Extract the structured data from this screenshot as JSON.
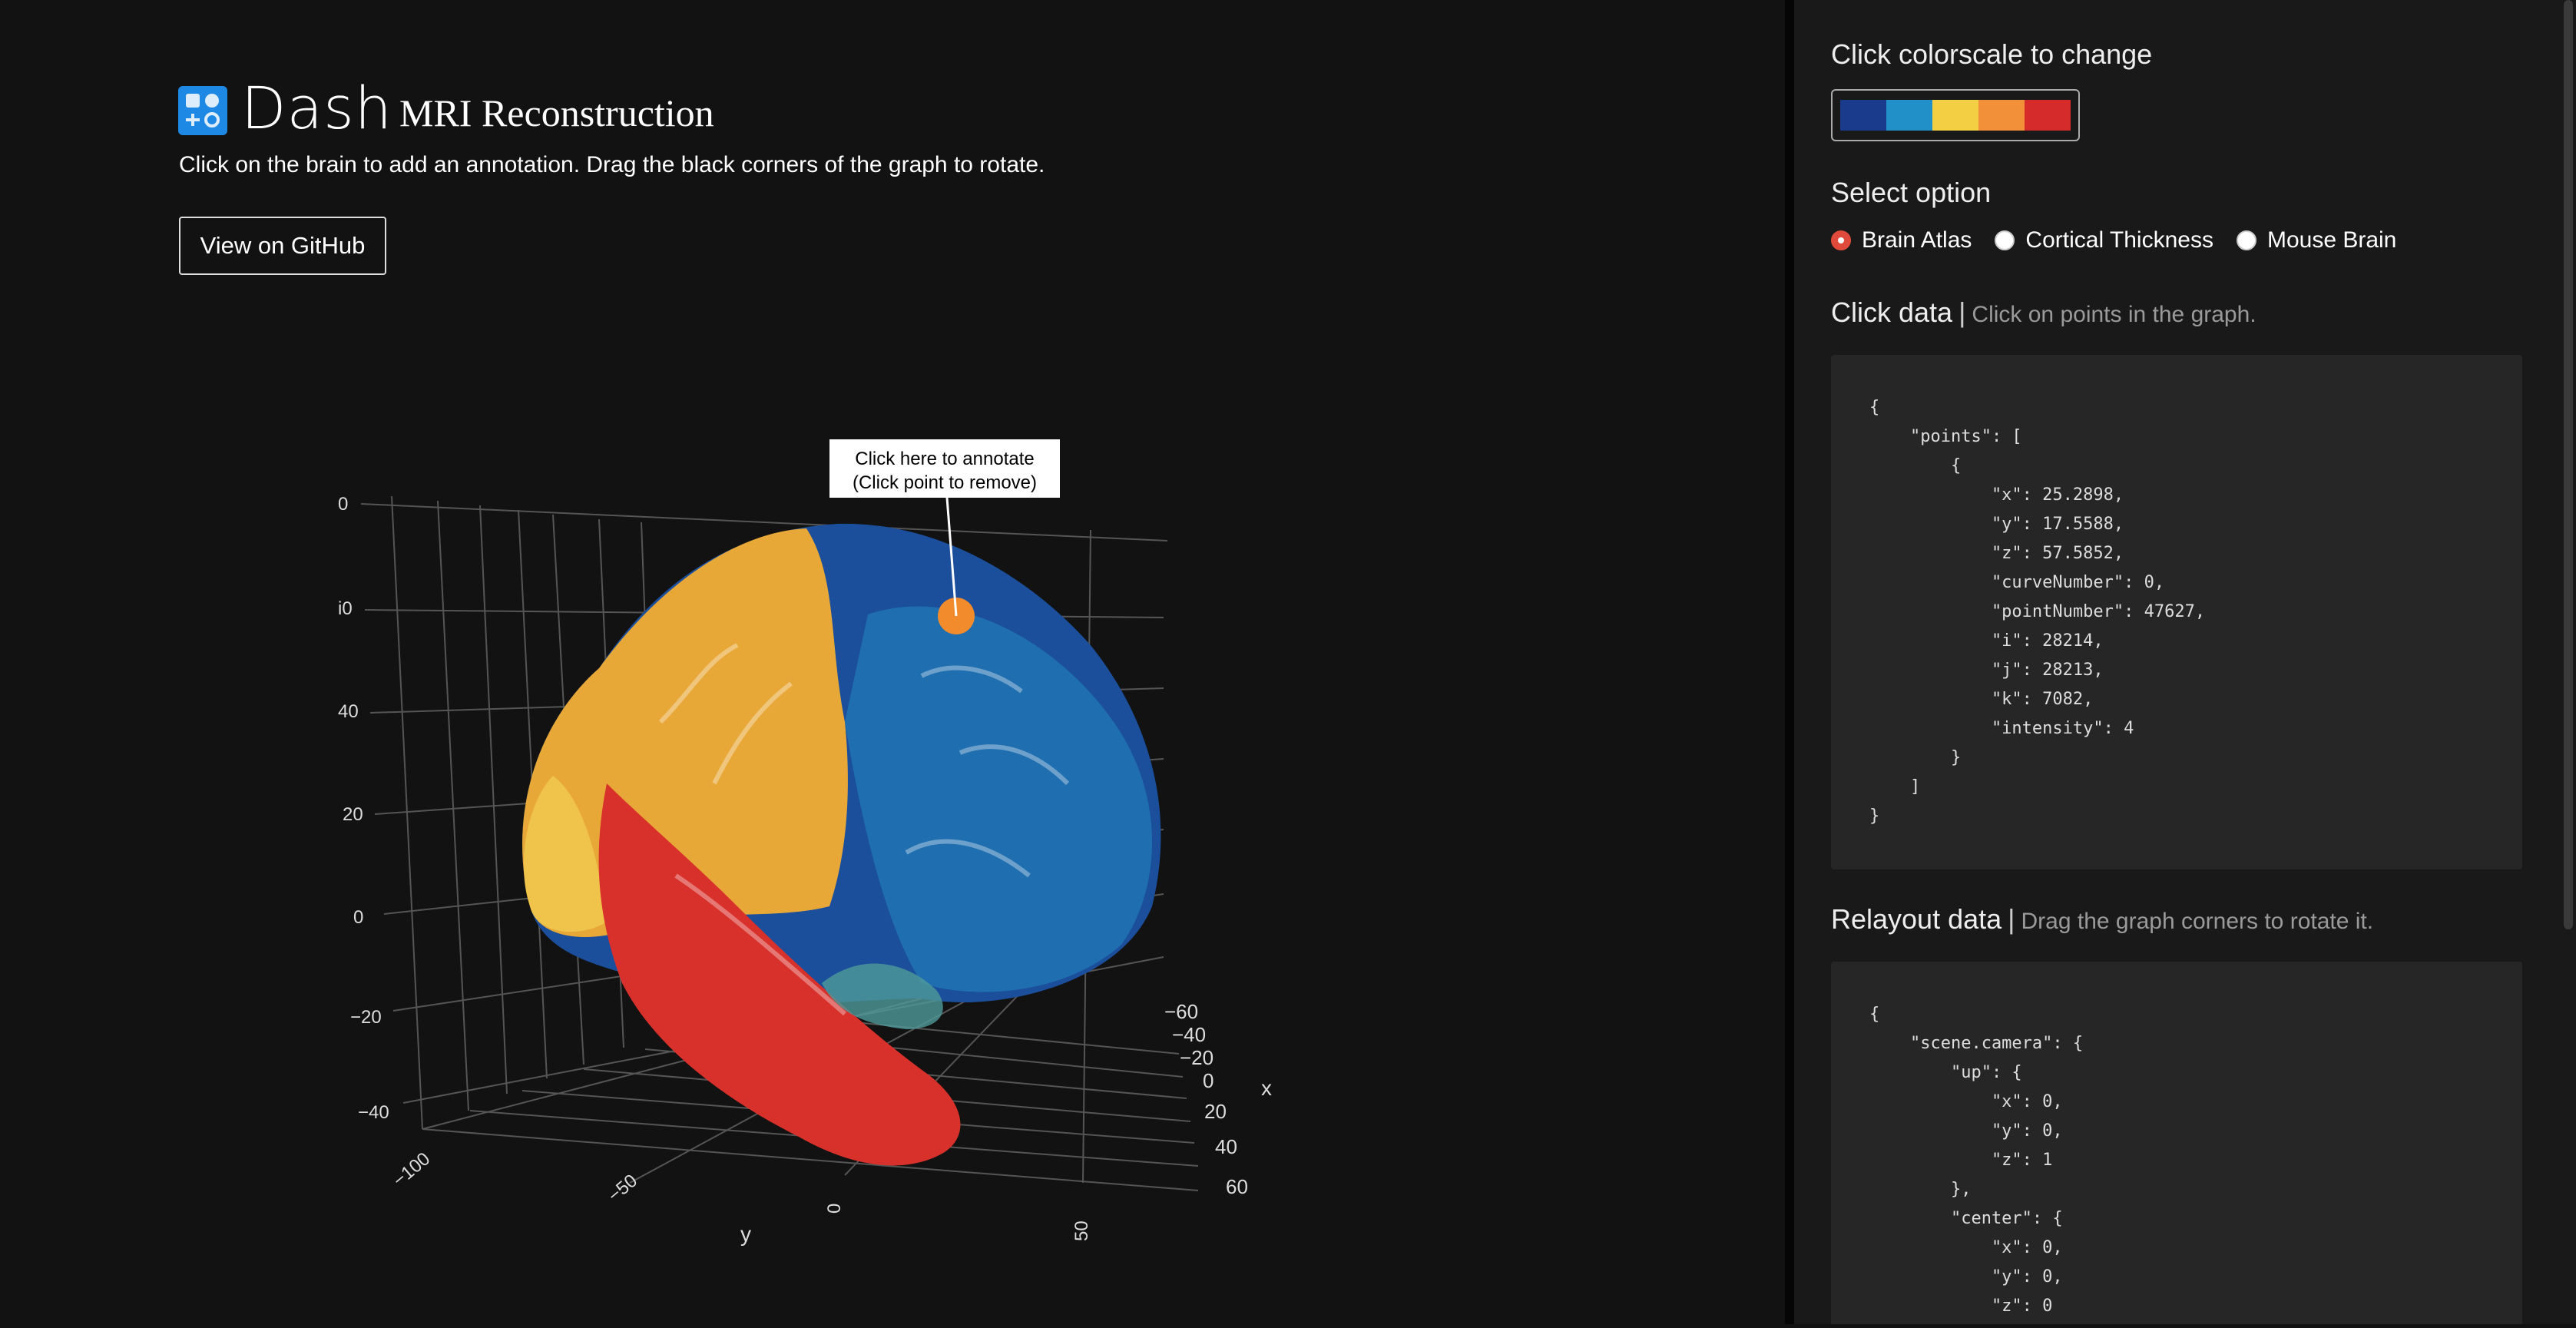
{
  "header": {
    "logo_text": "Dash",
    "app_title": "MRI Reconstruction",
    "subtitle": "Click on the brain to add an annotation. Drag the black corners of the graph to rotate.",
    "github_button": "View on GitHub"
  },
  "graph": {
    "annotation_line1": "Click here to annotate",
    "annotation_line2": "(Click point to remove)",
    "z_ticks": [
      "0",
      "i0",
      "40",
      "20",
      "0",
      "−20",
      "−40"
    ],
    "y_ticks": [
      "−100",
      "−50",
      "0",
      "50"
    ],
    "x_ticks": [
      "−60",
      "−40",
      "−20",
      "0",
      "20",
      "40",
      "60"
    ],
    "x_axis_label": "x",
    "y_axis_label": "y",
    "region_colors": {
      "frontal": "#e8a838",
      "parietal": "#1b4f9c",
      "temporal": "#d8302a",
      "occipital": "#1f6fb0",
      "highlight": "#f28b2c"
    }
  },
  "controls": {
    "colorscale_title": "Click colorscale to change",
    "colorscale": [
      "#1a3a8c",
      "#2190c9",
      "#f2cf43",
      "#f2903a",
      "#d62b2b"
    ],
    "select_title": "Select option",
    "options": [
      {
        "label": "Brain Atlas",
        "checked": true
      },
      {
        "label": "Cortical Thickness",
        "checked": false
      },
      {
        "label": "Mouse Brain",
        "checked": false
      }
    ],
    "click_title": "Click data",
    "click_hint": "Click on points in the graph.",
    "click_json": "{\n    \"points\": [\n        {\n            \"x\": 25.2898,\n            \"y\": 17.5588,\n            \"z\": 57.5852,\n            \"curveNumber\": 0,\n            \"pointNumber\": 47627,\n            \"i\": 28214,\n            \"j\": 28213,\n            \"k\": 7082,\n            \"intensity\": 4\n        }\n    ]\n}",
    "relayout_title": "Relayout data",
    "relayout_hint": "Drag the graph corners to rotate it.",
    "relayout_json": "{\n    \"scene.camera\": {\n        \"up\": {\n            \"x\": 0,\n            \"y\": 0,\n            \"z\": 1\n        },\n        \"center\": {\n            \"x\": 0,\n            \"y\": 0,\n            \"z\": 0"
  }
}
